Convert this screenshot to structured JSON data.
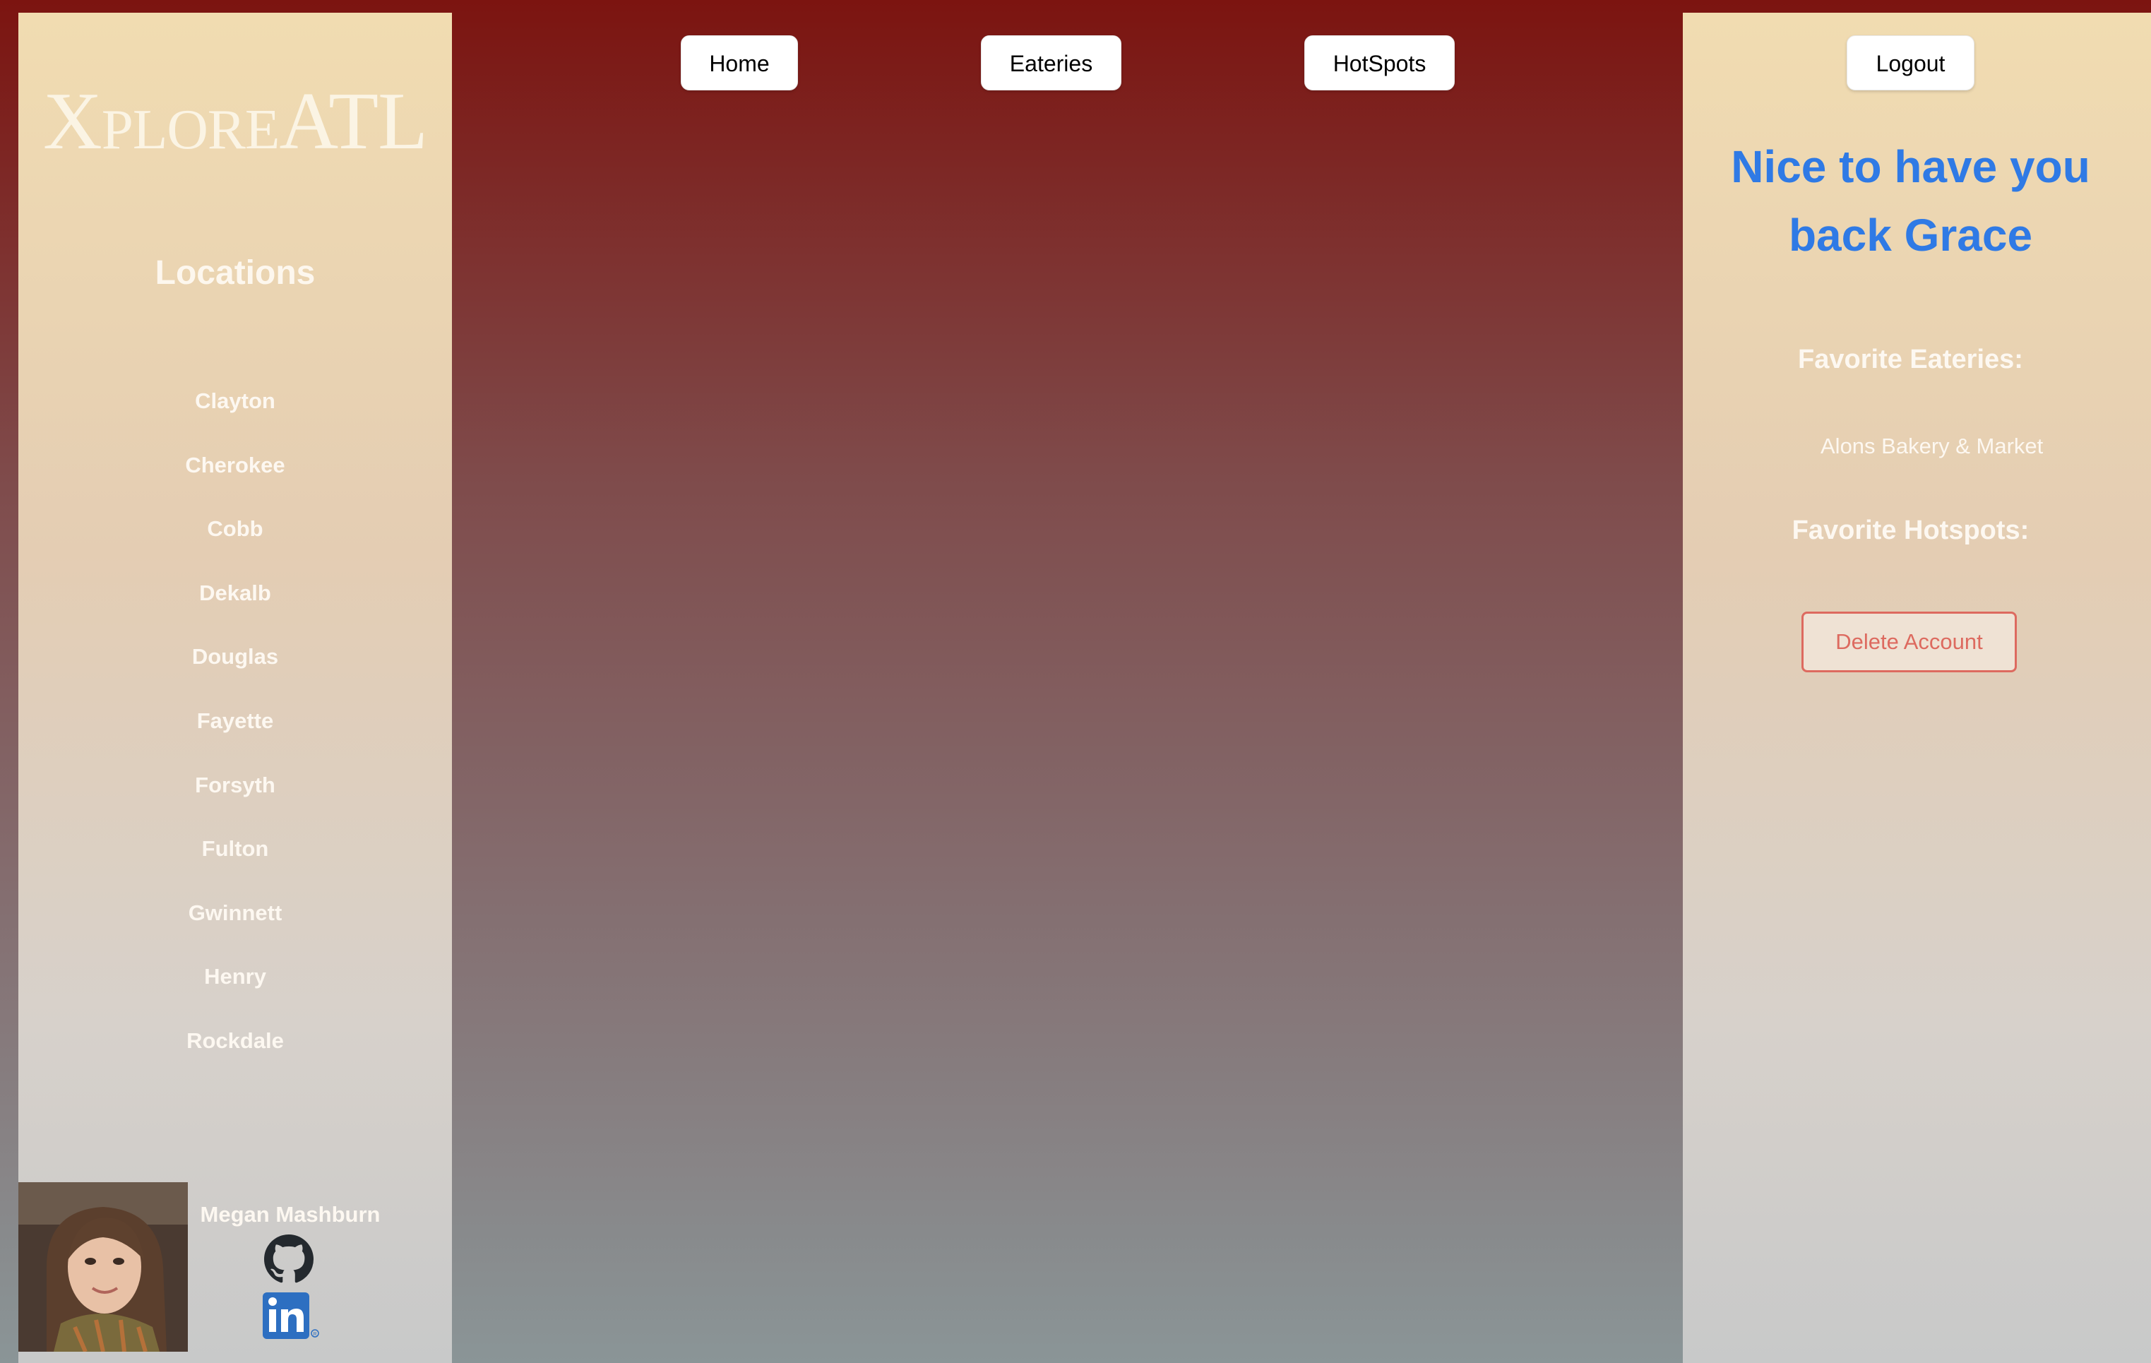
{
  "brand": {
    "name": "XploreATL"
  },
  "sidebar": {
    "locations_title": "Locations",
    "locations": [
      "Clayton",
      "Cherokee",
      "Cobb",
      "Dekalb",
      "Douglas",
      "Fayette",
      "Forsyth",
      "Fulton",
      "Gwinnett",
      "Henry",
      "Rockdale"
    ],
    "developer": {
      "name": "Megan Mashburn",
      "github_icon": "github-icon",
      "linkedin_icon": "linkedin-icon"
    }
  },
  "nav": {
    "home": "Home",
    "eateries": "Eateries",
    "hotspots": "HotSpots"
  },
  "account": {
    "logout": "Logout",
    "welcome": "Nice to have you back Grace",
    "favorite_eateries_title": "Favorite Eateries:",
    "favorite_eateries": [
      "Alons Bakery & Market"
    ],
    "favorite_hotspots_title": "Favorite Hotspots:",
    "favorite_hotspots": [],
    "delete_account": "Delete Account"
  },
  "colors": {
    "accent_blue": "#2f7ae5",
    "danger_red": "#dd6a5f",
    "background_top": "#7c1410",
    "panel_sand": "#f1dcb1"
  }
}
